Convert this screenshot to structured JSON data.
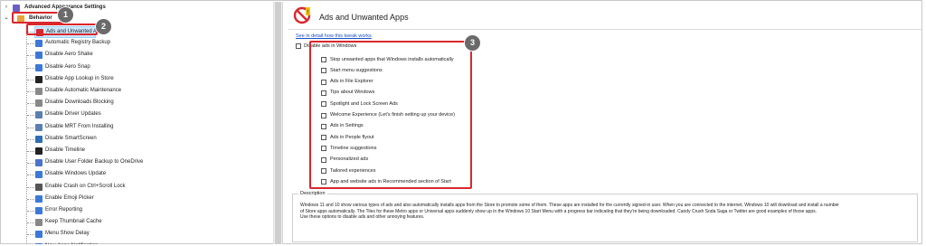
{
  "tree": {
    "top_items": [
      {
        "label": "Advanced Appearance Settings"
      },
      {
        "label": "Behavior"
      }
    ],
    "children": [
      {
        "label": "Ads and Unwanted Apps",
        "icon_color": "#d9272e",
        "selected": true
      },
      {
        "label": "Automatic Registry Backup",
        "icon_color": "#3c78d8"
      },
      {
        "label": "Disable Aero Shake",
        "icon_color": "#3c78d8"
      },
      {
        "label": "Disable Aero Snap",
        "icon_color": "#3c78d8"
      },
      {
        "label": "Disable App Lookup in Store",
        "icon_color": "#222222"
      },
      {
        "label": "Disable Automatic Maintenance",
        "icon_color": "#888888"
      },
      {
        "label": "Disable Downloads Blocking",
        "icon_color": "#888888"
      },
      {
        "label": "Disable Driver Updates",
        "icon_color": "#5a7fb0"
      },
      {
        "label": "Disable MRT From Installing",
        "icon_color": "#5a7fb0"
      },
      {
        "label": "Disable SmartScreen",
        "icon_color": "#2f6db5"
      },
      {
        "label": "Disable Timeline",
        "icon_color": "#222222"
      },
      {
        "label": "Disable User Folder Backup to OneDrive",
        "icon_color": "#4a74c9"
      },
      {
        "label": "Disable Windows Update",
        "icon_color": "#3c78d8"
      },
      {
        "label": "Enable Crash on Ctrl+Scroll Lock",
        "icon_color": "#555555"
      },
      {
        "label": "Enable Emoji Picker",
        "icon_color": "#3c78d8"
      },
      {
        "label": "Error Reporting",
        "icon_color": "#3c78d8"
      },
      {
        "label": "Keep Thumbnail Cache",
        "icon_color": "#888888"
      },
      {
        "label": "Menu Show Delay",
        "icon_color": "#3c78d8"
      },
      {
        "label": "New Apps Notification",
        "icon_color": "#3c78d8"
      }
    ]
  },
  "badges": {
    "one": "1",
    "two": "2",
    "three": "3"
  },
  "header": {
    "title": "Ads and Unwanted Apps"
  },
  "link": "See in detail how this tweak works",
  "master_checkbox": {
    "label": "Disable ads in Windows",
    "checked": false
  },
  "options": [
    {
      "label": "Stop unwanted apps that Windows installs automatically",
      "checked": false
    },
    {
      "label": "Start menu suggestions",
      "checked": false
    },
    {
      "label": "Ads in File Explorer",
      "checked": false
    },
    {
      "label": "Tips about Windows",
      "checked": false
    },
    {
      "label": "Spotlight and Lock Screen Ads",
      "checked": false
    },
    {
      "label": "Welcome Experience (Let's finish setting up your device)",
      "checked": false
    },
    {
      "label": "Ads in Settings",
      "checked": false
    },
    {
      "label": "Ads in People flyout",
      "checked": false
    },
    {
      "label": "Timeline suggestions",
      "checked": false
    },
    {
      "label": "Personalized ads",
      "checked": false
    },
    {
      "label": "Tailored experiences",
      "checked": false
    },
    {
      "label": "App and website ads in Recommended section of Start",
      "checked": false
    }
  ],
  "description": {
    "legend": "Description",
    "line1": "Windows 11 and 10 show various types of ads and also automatically installs apps from the Store to promote some of them. These apps are installed for the currently signed-in user. When you are connected to the internet, Windows 10 will download and install a number",
    "line2": "of Store apps automatically. The Tiles for these Metro apps or Universal apps suddenly show up in the Windows 10 Start Menu with a progress bar indicating that they're being downloaded. Candy Crush Soda Saga or Twitter are good examples of those apps.",
    "line3": "Use these options to disable ads and other annoying features."
  },
  "colors": {
    "accent_red": "#d9272e",
    "link_blue": "#1a4fc4",
    "selection": "#cde8ff"
  }
}
